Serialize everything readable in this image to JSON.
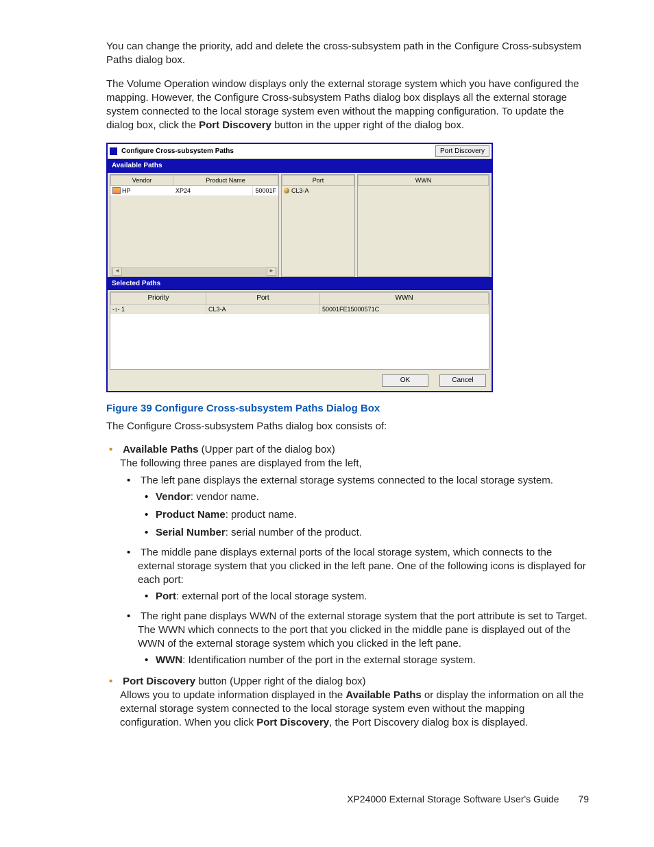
{
  "para1": "You can change the priority, add and delete the cross-subsystem path in the Configure Cross-subsystem Paths dialog box.",
  "para2_a": "The Volume Operation window displays only the external storage system which you have configured the mapping. However, the Configure Cross-subsystem Paths dialog box displays all the external storage system connected to the local storage system even without the mapping configuration. To update the dialog box, click the ",
  "para2_bold": "Port Discovery",
  "para2_b": " button in the upper right of the dialog box.",
  "dialog": {
    "title": "Configure Cross-subsystem Paths",
    "port_discovery_btn": "Port Discovery",
    "available_paths_label": "Available Paths",
    "selected_paths_label": "Selected Paths",
    "left_headers": {
      "vendor": "Vendor",
      "product": "Product Name"
    },
    "left_row": {
      "vendor": "HP",
      "product": "XP24",
      "serial": "50001F"
    },
    "mid_header": "Port",
    "mid_row": "CL3-A",
    "right_header": "WWN",
    "sel_headers": {
      "priority": "Priority",
      "port": "Port",
      "wwn": "WWN"
    },
    "sel_row": {
      "priority": "1",
      "port": "CL3-A",
      "wwn": "50001FE15000571C"
    },
    "ok": "OK",
    "cancel": "Cancel"
  },
  "fig_caption": "Figure 39 Configure Cross-subsystem Paths Dialog Box",
  "consists": "The Configure Cross-subsystem Paths dialog box consists of:",
  "bul": {
    "ap_bold": "Available Paths",
    "ap_tail": " (Upper part of the dialog box)",
    "ap_line2": "The following three panes are displayed from the left,",
    "left_pane": "The left pane displays the external storage systems connected to the local storage system.",
    "vendor_b": "Vendor",
    "vendor_t": ": vendor name.",
    "product_b": "Product Name",
    "product_t": ": product name.",
    "serial_b": "Serial Number",
    "serial_t": ": serial number of the product.",
    "mid_pane": "The middle pane displays external ports of the local storage system, which connects to the external storage system that you clicked in the left pane. One of the following icons is displayed for each port:",
    "port_b": "Port",
    "port_t": ": external port of the local storage system.",
    "right_pane": "The right pane displays WWN of the external storage system that the port attribute is set to Target. The WWN which connects to the port that you clicked in the middle pane is displayed out of the WWN of the external storage system which you clicked in the left pane.",
    "wwn_b": "WWN",
    "wwn_t": ": Identification number of the port in the external storage system.",
    "pd_bold": "Port Discovery",
    "pd_tail": " button (Upper right of the dialog box)",
    "pd_line_a": "Allows you to update information displayed in the ",
    "pd_line_bold1": "Available Paths",
    "pd_line_b": " or display the information on all the external storage system connected to the local storage system even without the mapping configuration. When you click ",
    "pd_line_bold2": "Port Discovery",
    "pd_line_c": ", the Port Discovery dialog box is displayed."
  },
  "footer_title": "XP24000 External Storage Software User's Guide",
  "footer_page": "79"
}
